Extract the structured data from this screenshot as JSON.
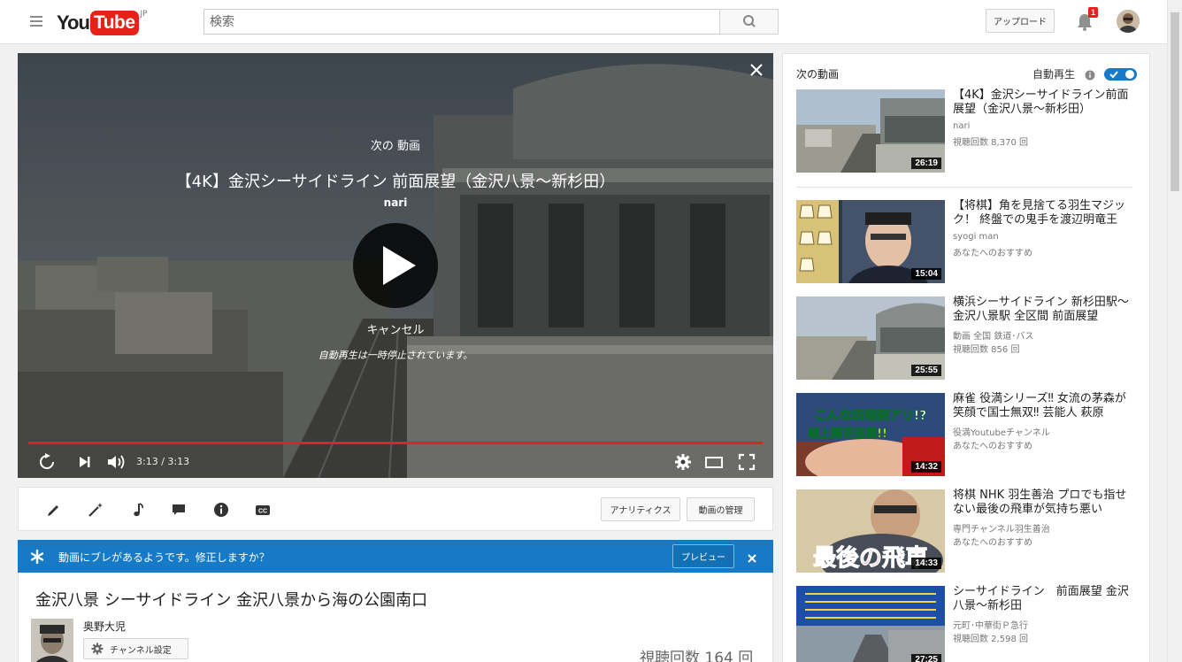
{
  "header": {
    "logo_you": "You",
    "logo_tube": "Tube",
    "region": "JP",
    "search_placeholder": "検索",
    "upload_label": "アップロード",
    "notification_count": "1"
  },
  "player": {
    "up_next_label": "次の 動画",
    "next_title": "【4K】金沢シーサイドライン 前面展望（金沢八景～新杉田）",
    "next_channel": "nari",
    "cancel_label": "キャンセル",
    "paused_message": "自動再生は一時停止されています。",
    "time": "3:13 / 3:13",
    "progress": 1.0
  },
  "actions": {
    "analytics_label": "アナリティクス",
    "manage_label": "動画の管理"
  },
  "banner": {
    "text": "動画にブレがあるようです。修正しますか？",
    "preview_label": "プレビュー"
  },
  "video": {
    "title": "金沢八景 シーサイドライン 金沢八景から海の公園南口",
    "owner": "奥野大児",
    "channel_settings_label": "チャンネル設定",
    "views": "視聴回数 164 回"
  },
  "sidebar": {
    "heading": "次の動画",
    "autoplay_label": "自動再生",
    "videos": [
      {
        "title": "【4K】金沢シーサイドライン前面展望（金沢八景～新杉田）",
        "channel": "nari",
        "meta": "視聴回数 8,370 回",
        "duration": "26:19"
      },
      {
        "title": "【将棋】角を見捨てる羽生マジック！ 終盤での鬼手を渡辺明竜王",
        "channel": "syogi man",
        "meta": "あなたへのおすすめ",
        "duration": "15:04"
      },
      {
        "title": "横浜シーサイドライン 新杉田駅～金沢八景駅 全区間 前面展望",
        "channel": "動画 全国 鉄道･バス",
        "meta": "視聴回数 856 回",
        "duration": "25:55"
      },
      {
        "title": "麻雀 役満シリーズ‼ 女流の茅森が笑顔で国士無双‼ 芸能人 萩原",
        "channel": "役満Youtubeチャンネル",
        "meta": "あなたへのおすすめ",
        "duration": "14:32",
        "overlay_top": "こんな四暗刻アリ!?",
        "overlay_bottom": "嶺上開花自摸!!"
      },
      {
        "title": "将棋 NHK 羽生善治 プロでも指せない最後の飛車が気持ち悪い",
        "channel": "専門チャンネル羽生善治",
        "meta": "あなたへのおすすめ",
        "duration": "14:33",
        "overlay": "最後の飛車"
      },
      {
        "title": "シーサイドライン　前面展望 金沢八景～新杉田",
        "channel": "元町･中華街Ｐ急行",
        "meta": "視聴回数 2,598 回",
        "duration": "27:25"
      }
    ]
  },
  "colors": {
    "accent": "#167ac6",
    "brand_red": "#e62117"
  }
}
